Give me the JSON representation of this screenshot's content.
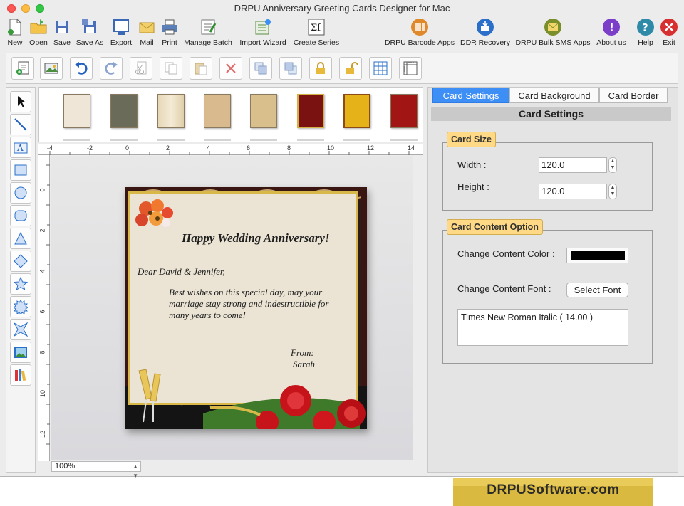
{
  "window": {
    "title": "DRPU Anniversary Greeting Cards Designer for Mac"
  },
  "toolbar": {
    "items": [
      {
        "label": "New",
        "icon": "new-file-icon"
      },
      {
        "label": "Open",
        "icon": "open-folder-icon"
      },
      {
        "label": "Save",
        "icon": "save-disk-icon"
      },
      {
        "label": "Save As",
        "icon": "save-as-icon"
      },
      {
        "label": "Export",
        "icon": "export-icon"
      },
      {
        "label": "Mail",
        "icon": "mail-icon"
      },
      {
        "label": "Print",
        "icon": "printer-icon"
      },
      {
        "label": "Manage Batch",
        "icon": "manage-batch-icon"
      },
      {
        "label": "Import Wizard",
        "icon": "import-wizard-icon"
      },
      {
        "label": "Create Series",
        "icon": "create-series-icon"
      },
      {
        "label": "DRPU Barcode Apps",
        "icon": "barcode-icon"
      },
      {
        "label": "DDR Recovery",
        "icon": "recovery-icon"
      },
      {
        "label": "DRPU Bulk SMS Apps",
        "icon": "sms-icon"
      },
      {
        "label": "About us",
        "icon": "about-icon"
      },
      {
        "label": "Help",
        "icon": "help-icon"
      },
      {
        "label": "Exit",
        "icon": "exit-icon"
      }
    ]
  },
  "ruler": {
    "h_ticks": [
      "-4",
      "-2",
      "0",
      "2",
      "4",
      "6",
      "8",
      "10",
      "12",
      "14"
    ],
    "v_ticks": [
      "0",
      "2",
      "4",
      "6",
      "8",
      "10",
      "12"
    ]
  },
  "zoom": {
    "value": "100%"
  },
  "card": {
    "heading": "Happy Wedding Anniversary!",
    "greeting": "Dear David & Jennifer,",
    "message_line1": "Best wishes on this special day, may your",
    "message_line2": "marriage stay strong and indestructible for",
    "message_line3": "many years to come!",
    "from_label": "From:",
    "from_name": "Sarah"
  },
  "panel": {
    "tabs": [
      "Card Settings",
      "Card Background",
      "Card Border"
    ],
    "active_tab": "Card Settings",
    "header": "Card Settings",
    "card_size": {
      "title": "Card Size",
      "width_label": "Width :",
      "width_value": "120.0",
      "height_label": "Height :",
      "height_value": "120.0"
    },
    "content_option": {
      "title": "Card Content Option",
      "color_label": "Change Content Color :",
      "color_value": "#000000",
      "font_label": "Change Content Font :",
      "font_button": "Select Font",
      "font_value": "Times New Roman Italic ( 14.00 )"
    }
  },
  "brand": {
    "text": "DRPUSoftware.com"
  },
  "colors": {
    "accent": "#3d8ef5",
    "group_title": "#ffd985",
    "brand": "#d9b940"
  }
}
